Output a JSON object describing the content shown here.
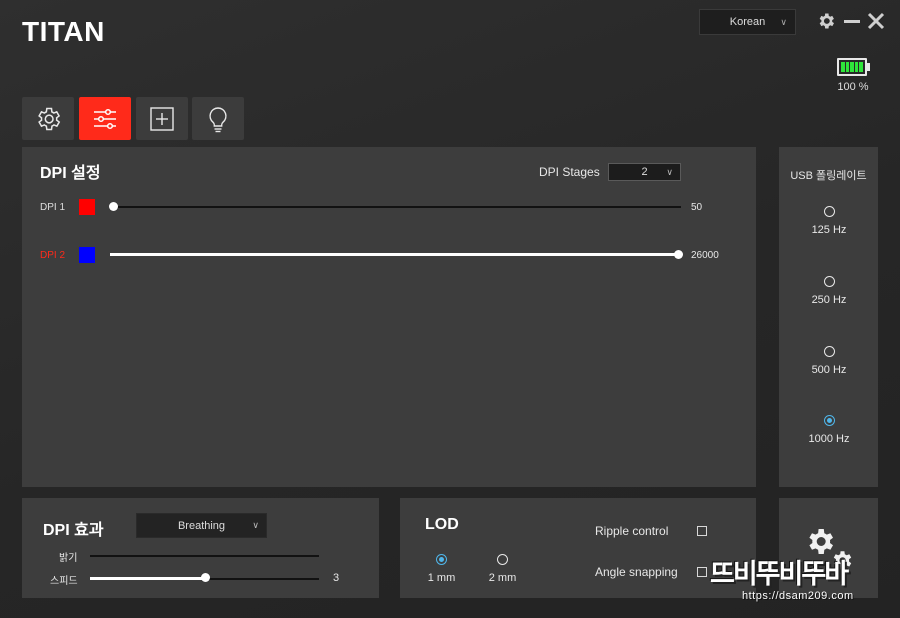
{
  "app": {
    "logo": "TITAN"
  },
  "header": {
    "language": "Korean",
    "settings_icon": "gear-icon",
    "minimize_icon": "minimize-icon",
    "close_icon": "close-icon"
  },
  "battery": {
    "level_percent": 100,
    "label": "100 %"
  },
  "tabs": [
    {
      "icon": "gear-icon",
      "active": false
    },
    {
      "icon": "sliders-icon",
      "active": true
    },
    {
      "icon": "plus-box-icon",
      "active": false
    },
    {
      "icon": "lightbulb-icon",
      "active": false
    }
  ],
  "dpi_settings": {
    "title": "DPI 설정",
    "stages_label": "DPI Stages",
    "stages_value": "2",
    "stages": [
      {
        "label": "DPI 1",
        "color": "#ff0000",
        "value": 50,
        "value_text": "50",
        "fraction": 0.0,
        "active": false
      },
      {
        "label": "DPI 2",
        "color": "#0000ff",
        "value": 26000,
        "value_text": "26000",
        "fraction": 1.0,
        "active": true
      }
    ]
  },
  "polling": {
    "title": "USB 폴링레이트",
    "options": [
      "125 Hz",
      "250 Hz",
      "500 Hz",
      "1000 Hz"
    ],
    "selected": "1000 Hz"
  },
  "dpi_effect": {
    "title": "DPI 효과",
    "mode": "Breathing",
    "brightness_label": "밝기",
    "brightness_fraction": 0.0,
    "speed_label": "스피드",
    "speed_value": "3",
    "speed_fraction": 0.5
  },
  "lod": {
    "title": "LOD",
    "options": [
      "1 mm",
      "2 mm"
    ],
    "selected": "1 mm",
    "ripple_label": "Ripple control",
    "ripple_checked": false,
    "angle_label": "Angle snapping",
    "angle_checked": false
  },
  "watermark": {
    "line1": "뜨비뚜비뚜바",
    "line2": "https://dsam209.com"
  },
  "colors": {
    "accent": "#ff2a1a",
    "radio_selected": "#4fb6ea",
    "battery": "#2ee63a",
    "panel": "#3d3d3d"
  }
}
